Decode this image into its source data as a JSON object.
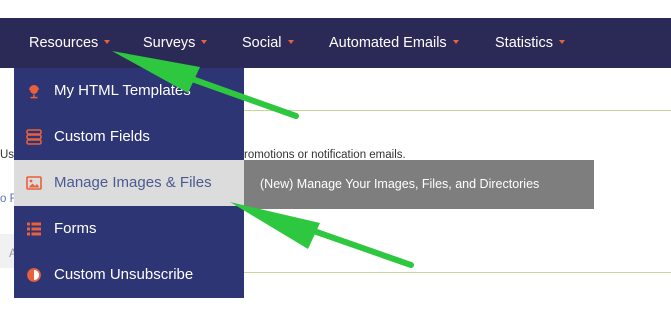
{
  "colors": {
    "nav_bg": "#2b2a57",
    "menu_bg": "#2d3574",
    "accent": "#e8603c",
    "active_item_bg": "#dcdcdc",
    "tooltip_bg": "#7e7e7e",
    "arrow": "#2ec740"
  },
  "nav": {
    "items": [
      {
        "label": "Resources"
      },
      {
        "label": "Surveys"
      },
      {
        "label": "Social"
      },
      {
        "label": "Automated Emails"
      },
      {
        "label": "Statistics"
      }
    ]
  },
  "dropdown": {
    "items": [
      {
        "label": "My HTML Templates",
        "icon": "globe-icon"
      },
      {
        "label": "Custom Fields",
        "icon": "database-icon"
      },
      {
        "label": "Manage Images & Files",
        "icon": "image-icon",
        "active": true
      },
      {
        "label": "Forms",
        "icon": "list-icon"
      },
      {
        "label": "Custom Unsubscribe",
        "icon": "contrast-icon"
      }
    ]
  },
  "tooltip": {
    "text": "(New) Manage Your Images, Files, and Directories"
  },
  "background": {
    "text_fragment_left": "Us",
    "text_fragment_right": "romotions or notification emails.",
    "link_fragment": "o F",
    "gray_fragment": "A"
  }
}
